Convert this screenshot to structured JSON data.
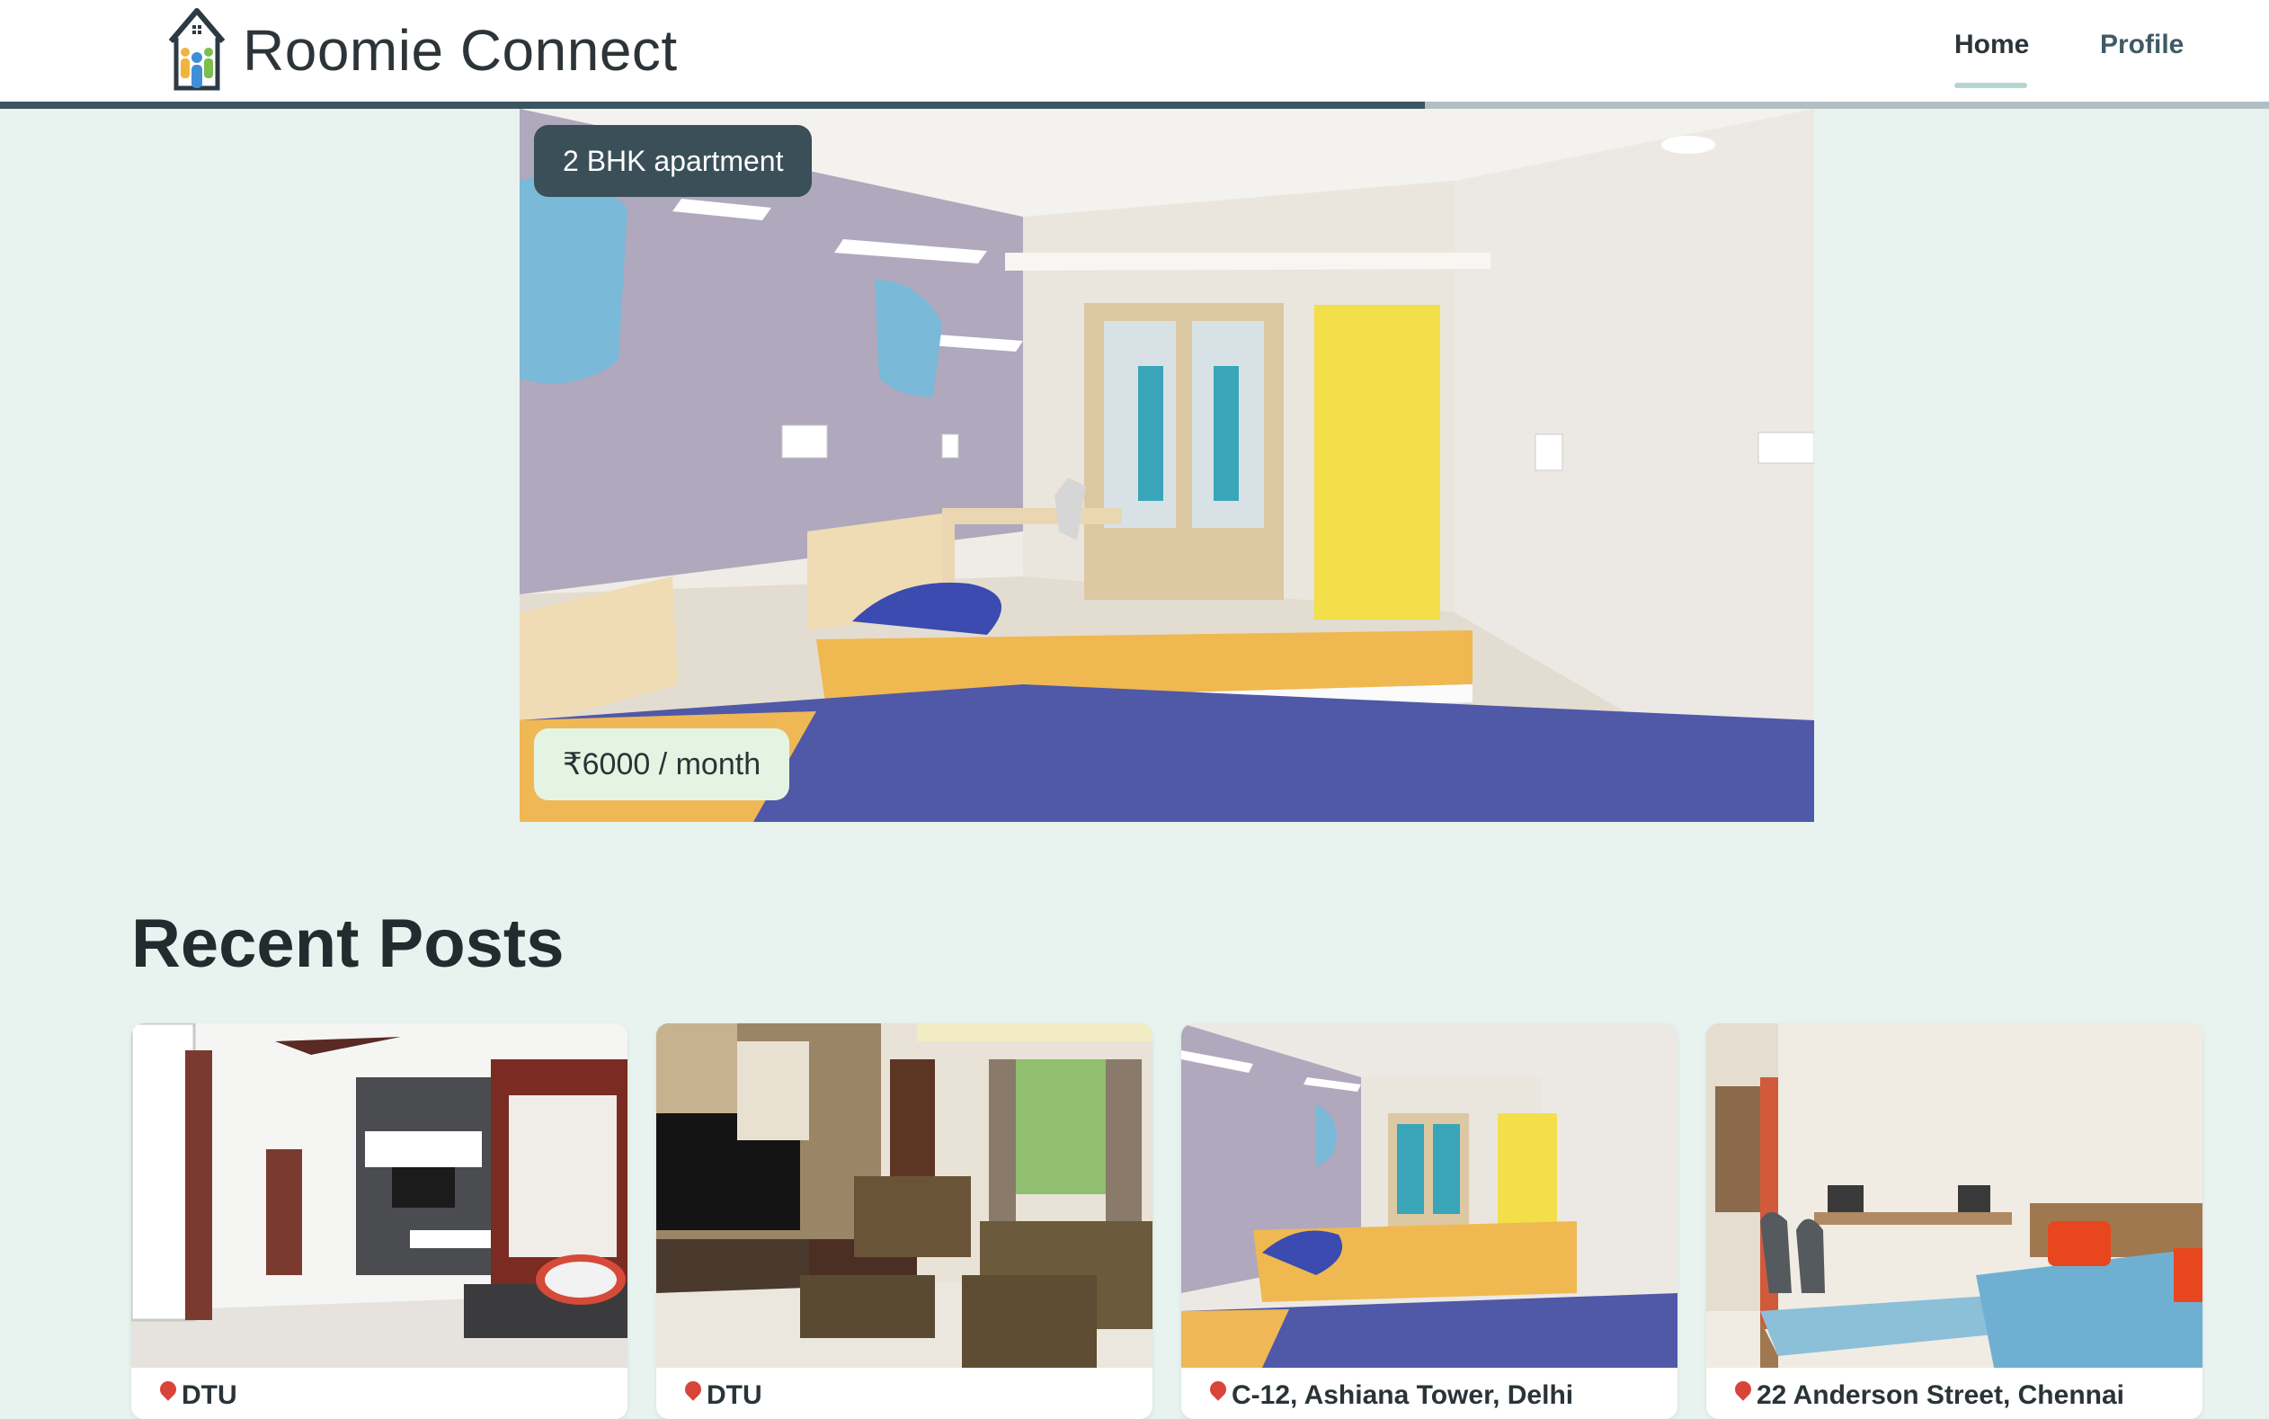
{
  "app": {
    "brand": "Roomie Connect"
  },
  "nav": {
    "items": [
      {
        "label": "Home",
        "active": true
      },
      {
        "label": "Profile",
        "active": false
      }
    ]
  },
  "carousel": {
    "progress": 0.628
  },
  "featured": {
    "title": "2 BHK apartment",
    "price": "₹6000 / month"
  },
  "recent_posts": {
    "heading": "Recent Posts",
    "cards": [
      {
        "location": "DTU",
        "image": "living-room-photo"
      },
      {
        "location": "DTU",
        "image": "living-room-sofa-photo"
      },
      {
        "location": "C-12, Ashiana Tower, Delhi",
        "image": "shared-bedroom-photo"
      },
      {
        "location": "22 Anderson Street, Chennai",
        "image": "hostel-bedroom-photo"
      }
    ]
  },
  "icons": {
    "logo": "house-people-logo-icon",
    "pin": "location-pin-icon"
  },
  "colors": {
    "background": "#e8f3ef",
    "accent": "#3c5560",
    "price_pill": "#e3f5e2",
    "title_pill": "#3a4f58"
  }
}
